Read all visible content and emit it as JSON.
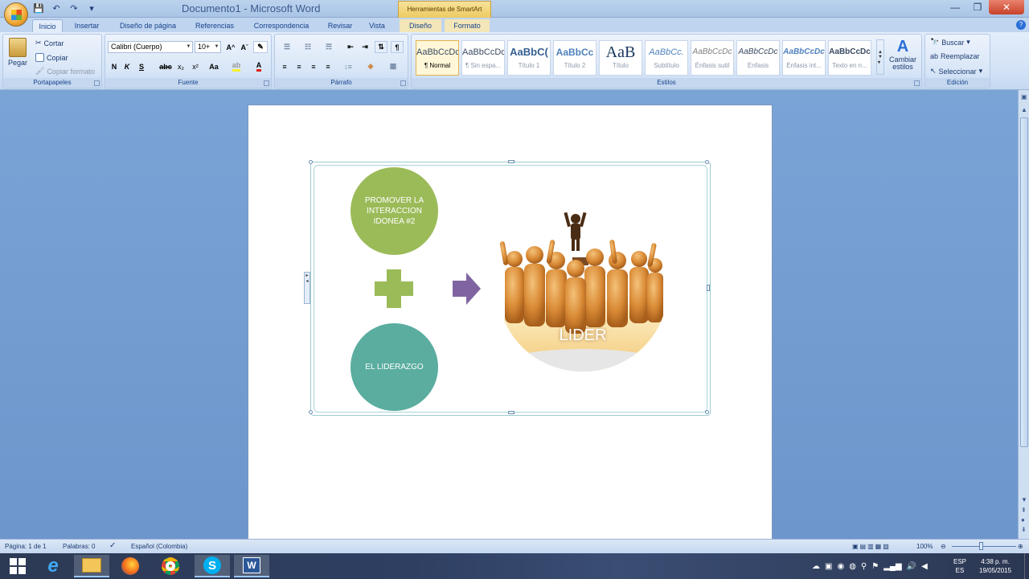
{
  "window": {
    "title": "Documento1 - Microsoft Word",
    "context_tab_group": "Herramientas de SmartArt"
  },
  "tabs": [
    "Inicio",
    "Insertar",
    "Diseño de página",
    "Referencias",
    "Correspondencia",
    "Revisar",
    "Vista",
    "Diseño",
    "Formato"
  ],
  "clipboard": {
    "paste": "Pegar",
    "cut": "Cortar",
    "copy": "Copiar",
    "format_painter": "Copiar formato",
    "label": "Portapapeles"
  },
  "font": {
    "name": "Calibri (Cuerpo)",
    "size": "10+",
    "label": "Fuente",
    "bold": "N",
    "italic": "K",
    "underline": "S",
    "strike": "abc",
    "subscript": "x₂",
    "superscript": "x²",
    "case": "Aa"
  },
  "paragraph": {
    "label": "Párrafo"
  },
  "styles": {
    "label": "Estilos",
    "items": [
      {
        "preview": "AaBbCcDc",
        "name": "¶ Normal"
      },
      {
        "preview": "AaBbCcDc",
        "name": "¶ Sin espa..."
      },
      {
        "preview": "AaBbC(",
        "name": "Título 1"
      },
      {
        "preview": "AaBbCc",
        "name": "Título 2"
      },
      {
        "preview": "AaB",
        "name": "Título"
      },
      {
        "preview": "AaBbCc.",
        "name": "Subtítulo"
      },
      {
        "preview": "AaBbCcDc",
        "name": "Énfasis sutil"
      },
      {
        "preview": "AaBbCcDc",
        "name": "Énfasis"
      },
      {
        "preview": "AaBbCcDc",
        "name": "Énfasis int..."
      },
      {
        "preview": "AaBbCcDc",
        "name": "Texto en n..."
      }
    ],
    "change": "Cambiar estilos"
  },
  "editing": {
    "label": "Edición",
    "find": "Buscar",
    "replace": "Reemplazar",
    "select": "Seleccionar"
  },
  "smartart": {
    "circle1": "PROMOVER LA INTERACCION IDONEA #2",
    "circle2": "EL LIDERAZGO",
    "result": "LIDER"
  },
  "status": {
    "page": "Página: 1 de 1",
    "words": "Palabras: 0",
    "language": "Español (Colombia)",
    "zoom": "100%"
  },
  "tray": {
    "lang1": "ESP",
    "lang2": "ES",
    "time": "4:38 p. m.",
    "date": "19/05/2015"
  },
  "colors": {
    "green": "#9bbb59",
    "teal": "#5aad9f",
    "purple": "#8064a2"
  }
}
